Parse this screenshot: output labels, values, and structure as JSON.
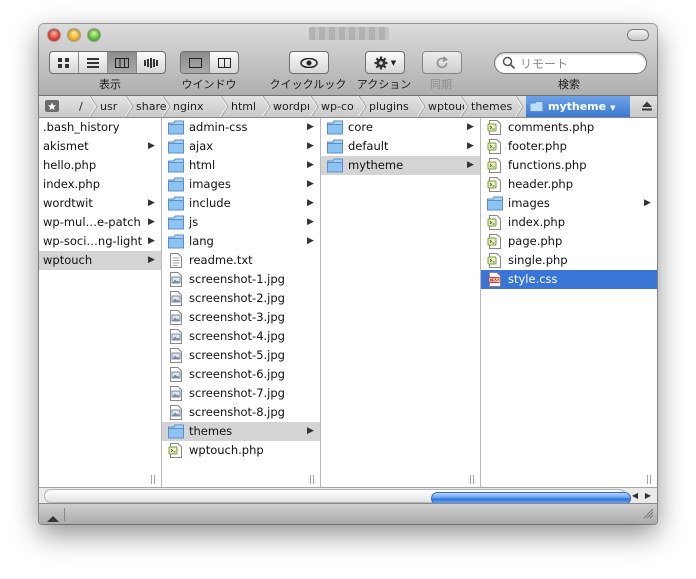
{
  "toolbar": {
    "view_label": "表示",
    "window_label": "ウインドウ",
    "quicklook_label": "クイックルック",
    "action_label": "アクション",
    "sync_label": "同期",
    "search_label": "検索",
    "search_placeholder": "リモート"
  },
  "path": {
    "items": [
      "/",
      "usr",
      "share",
      "nginx",
      "html",
      "wordpr",
      "wp-co",
      "plugins",
      "wptouc",
      "themes",
      "mytheme"
    ]
  },
  "columns": [
    {
      "items": [
        {
          "label": ".bash_history",
          "type": "plain",
          "arrow": false
        },
        {
          "label": "akismet",
          "type": "plain",
          "arrow": true
        },
        {
          "label": "hello.php",
          "type": "plain",
          "arrow": false
        },
        {
          "label": "index.php",
          "type": "plain",
          "arrow": false
        },
        {
          "label": "wordtwit",
          "type": "plain",
          "arrow": true
        },
        {
          "label": "wp-mul…e-patch",
          "type": "plain",
          "arrow": true
        },
        {
          "label": "wp-soci…ng-light",
          "type": "plain",
          "arrow": true
        },
        {
          "label": "wptouch",
          "type": "plain",
          "arrow": true,
          "selected": "gray"
        }
      ]
    },
    {
      "items": [
        {
          "label": "admin-css",
          "type": "folder",
          "arrow": true
        },
        {
          "label": "ajax",
          "type": "folder",
          "arrow": true
        },
        {
          "label": "html",
          "type": "folder",
          "arrow": true
        },
        {
          "label": "images",
          "type": "folder",
          "arrow": true
        },
        {
          "label": "include",
          "type": "folder",
          "arrow": true
        },
        {
          "label": "js",
          "type": "folder",
          "arrow": true
        },
        {
          "label": "lang",
          "type": "folder",
          "arrow": true
        },
        {
          "label": "readme.txt",
          "type": "text",
          "arrow": false
        },
        {
          "label": "screenshot-1.jpg",
          "type": "image",
          "arrow": false
        },
        {
          "label": "screenshot-2.jpg",
          "type": "image",
          "arrow": false
        },
        {
          "label": "screenshot-3.jpg",
          "type": "image",
          "arrow": false
        },
        {
          "label": "screenshot-4.jpg",
          "type": "image",
          "arrow": false
        },
        {
          "label": "screenshot-5.jpg",
          "type": "image",
          "arrow": false
        },
        {
          "label": "screenshot-6.jpg",
          "type": "image",
          "arrow": false
        },
        {
          "label": "screenshot-7.jpg",
          "type": "image",
          "arrow": false
        },
        {
          "label": "screenshot-8.jpg",
          "type": "image",
          "arrow": false
        },
        {
          "label": "themes",
          "type": "folder",
          "arrow": true,
          "selected": "gray"
        },
        {
          "label": "wptouch.php",
          "type": "php",
          "arrow": false
        }
      ]
    },
    {
      "items": [
        {
          "label": "core",
          "type": "folder",
          "arrow": true
        },
        {
          "label": "default",
          "type": "folder",
          "arrow": true
        },
        {
          "label": "mytheme",
          "type": "folder",
          "arrow": true,
          "selected": "gray"
        }
      ]
    },
    {
      "items": [
        {
          "label": "comments.php",
          "type": "php",
          "arrow": false
        },
        {
          "label": "footer.php",
          "type": "php",
          "arrow": false
        },
        {
          "label": "functions.php",
          "type": "php",
          "arrow": false
        },
        {
          "label": "header.php",
          "type": "php",
          "arrow": false
        },
        {
          "label": "images",
          "type": "folder",
          "arrow": true
        },
        {
          "label": "index.php",
          "type": "php",
          "arrow": false
        },
        {
          "label": "page.php",
          "type": "php",
          "arrow": false
        },
        {
          "label": "single.php",
          "type": "php",
          "arrow": false
        },
        {
          "label": "style.css",
          "type": "css",
          "arrow": false,
          "selected": "blue"
        }
      ]
    }
  ],
  "icons": {
    "css_badge": "CSS"
  },
  "colors": {
    "selection_blue": "#3875d7",
    "folder_blue": "#8cc3f2"
  }
}
